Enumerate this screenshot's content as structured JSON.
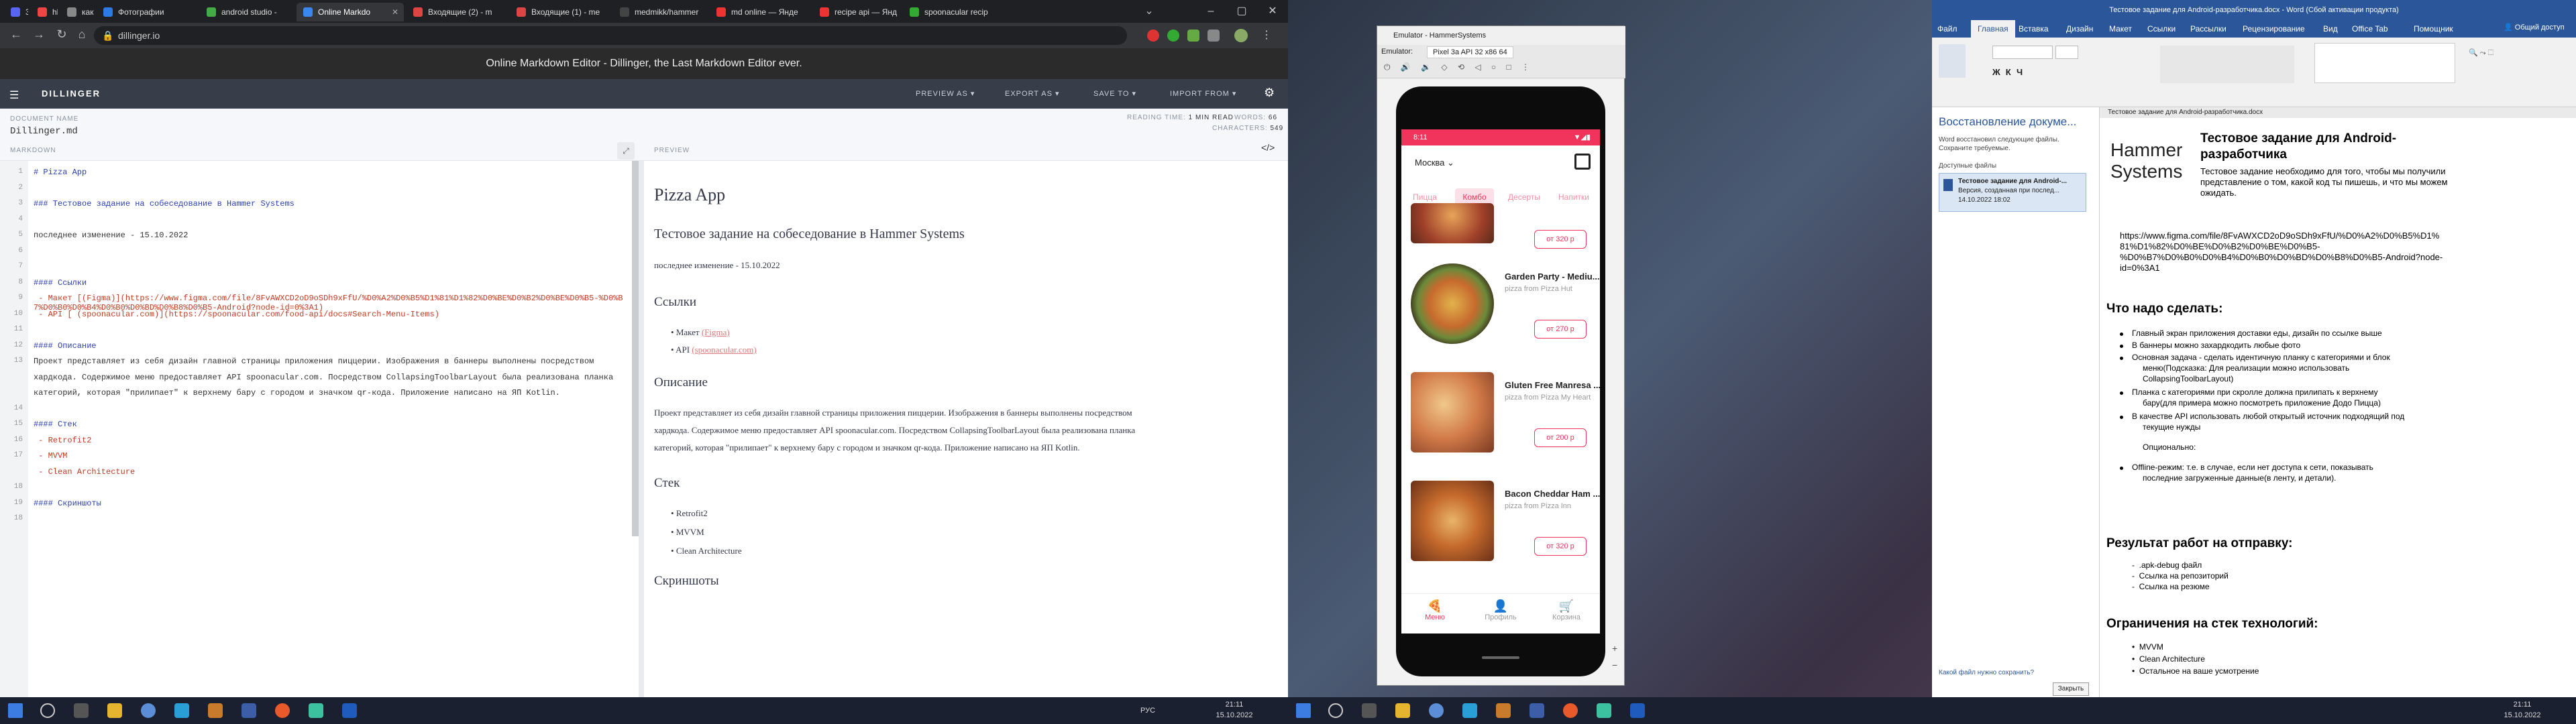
{
  "browser": {
    "tabs": [
      {
        "label": "3",
        "active": false
      },
      {
        "label": "hh",
        "active": false
      },
      {
        "label": "как",
        "active": false
      },
      {
        "label": "Фотографии",
        "active": false
      },
      {
        "label": "android studio - ",
        "active": false
      },
      {
        "label": "Online Markdo",
        "active": true
      },
      {
        "label": "Входящие (2) - m",
        "active": false
      },
      {
        "label": "Входящие (1) - me",
        "active": false
      },
      {
        "label": "medmikk/hammer",
        "active": false
      },
      {
        "label": "md online — Янде",
        "active": false
      },
      {
        "label": "recipe api — Янд",
        "active": false
      },
      {
        "label": "spoonacular recip",
        "active": false
      }
    ],
    "url": "dillinger.io",
    "page_title": "Online Markdown Editor - Dillinger, the Last Markdown Editor ever."
  },
  "dillinger": {
    "brand": "DILLINGER",
    "menu": [
      "PREVIEW AS",
      "EXPORT AS",
      "SAVE TO",
      "IMPORT FROM"
    ],
    "document_name_label": "DOCUMENT NAME",
    "document_name": "Dillinger.md",
    "reading_time_label": "READING TIME:",
    "reading_time": "1 MIN READ",
    "words_label": "WORDS:",
    "words": "66",
    "characters_label": "CHARACTERS:",
    "characters": "549",
    "markdown_label": "MARKDOWN",
    "preview_label": "PREVIEW",
    "lines": [
      {
        "n": "1",
        "text": "# Pizza App",
        "kind": "h"
      },
      {
        "n": "2",
        "text": "",
        "kind": ""
      },
      {
        "n": "3",
        "text": "### Тестовое задание на собеседование в Hammer Systems",
        "kind": "h"
      },
      {
        "n": "4",
        "text": "",
        "kind": ""
      },
      {
        "n": "5",
        "text": "последнее изменение - 15.10.2022",
        "kind": ""
      },
      {
        "n": "6",
        "text": "",
        "kind": ""
      },
      {
        "n": "7",
        "text": "",
        "kind": ""
      },
      {
        "n": "8",
        "text": "#### Ссылки",
        "kind": "h"
      },
      {
        "n": "9",
        "text": " - Макет [(Figma)](https://www.figma.com/file/8FvAWXCD2oD9oSDh9xFfU/%D0%A2%D0%B5%D1%81%D1%82%D0%BE%D0%B2%D0%BE%D0%B5-%D0%B7%D0%B0%D0%B4%D0%B0%D0%BD%D0%B8%D0%B5-Android?node-id=0%3A1)",
        "kind": "lk"
      },
      {
        "n": "10",
        "text": " - API [ (spoonacular.com)](https://spoonacular.com/food-api/docs#Search-Menu-Items)",
        "kind": "lk"
      },
      {
        "n": "11",
        "text": "",
        "kind": ""
      },
      {
        "n": "12",
        "text": "#### Описание",
        "kind": "h"
      },
      {
        "n": "13",
        "text": "Проект представляет из себя дизайн главной страницы приложения пиццерии. Изображения в баннеры выполнены посредством",
        "kind": ""
      },
      {
        "n": "",
        "text": "хардкода. Содержимое меню предоставляет API spoonacular.com. Посредством CollapsingToolbarLayout была реализована планка",
        "kind": ""
      },
      {
        "n": "",
        "text": "категорий, которая \"прилипает\" к верхнему бару с городом и значком qr-кода. Приложение написано на ЯП Kotlin.",
        "kind": ""
      },
      {
        "n": "14",
        "text": "",
        "kind": ""
      },
      {
        "n": "15",
        "text": "#### Стек",
        "kind": "h"
      },
      {
        "n": "16",
        "text": " - Retrofit2",
        "kind": "lk"
      },
      {
        "n": "17",
        "text": " - MVVM",
        "kind": "lk"
      },
      {
        "n": "",
        "text": " - Clean Architecture",
        "kind": "lk"
      },
      {
        "n": "18",
        "text": "",
        "kind": ""
      },
      {
        "n": "19",
        "text": "#### Скриншоты",
        "kind": "h"
      },
      {
        "n": "18",
        "text": "",
        "kind": ""
      }
    ],
    "preview": {
      "h1": "Pizza App",
      "h3": "Тестовое задание на собеседование в Hammer Systems",
      "modified": "последнее изменение - 15.10.2022",
      "links_h": "Ссылки",
      "link1_prefix": "Макет",
      "link1": "(Figma)",
      "link2_prefix": "API",
      "link2": "(spoonacular.com)",
      "desc_h": "Описание",
      "desc1": "Проект представляет из себя дизайн главной страницы приложения пиццерии. Изображения в баннеры выполнены посредством",
      "desc2": "хардкода. Содержимое меню предоставляет API spoonacular.com. Посредством CollapsingToolbarLayout была реализована планка",
      "desc3": "категорий, которая \"прилипает\" к верхнему бару с городом и значком qr-кода. Приложение написано на ЯП Kotlin.",
      "stack_h": "Стек",
      "stack": [
        "Retrofit2",
        "MVVM",
        "Clean Architecture"
      ],
      "screens_h": "Скриншоты"
    }
  },
  "taskbar": {
    "lang": "РУС",
    "time": "21:11",
    "date": "15.10.2022"
  },
  "emulator": {
    "title": "Emulator - HammerSystems",
    "tab": "Emulator:",
    "device": "Pixel 3a API 32 x86 64",
    "app": {
      "time": "8:11",
      "city": "Москва",
      "categories": [
        "Пицца",
        "Комбо",
        "Десерты",
        "Напитки"
      ],
      "items": [
        {
          "name": "",
          "desc": "",
          "price": "от 320 р"
        },
        {
          "name": "Garden Party - Mediu...",
          "desc": "pizza from Pizza Hut",
          "price": "от 270 р"
        },
        {
          "name": "Gluten Free Manresa ...",
          "desc": "pizza from Pizza My Heart",
          "price": "от 200 р"
        },
        {
          "name": "Bacon Cheddar Ham ...",
          "desc": "pizza from Pizza Inn",
          "price": "от 320 р"
        }
      ],
      "nav": [
        "Меню",
        "Профиль",
        "Корзина"
      ]
    }
  },
  "word": {
    "title": "Тестовое задание для Android-разработчика.docx - Word (Сбой активации продукта)",
    "ribbon_tabs": [
      "Файл",
      "Главная",
      "Вставка",
      "Дизайн",
      "Макет",
      "Ссылки",
      "Рассылки",
      "Рецензирование",
      "Вид",
      "Office Tab",
      "Помощник"
    ],
    "share": "Общий доступ",
    "recovery": {
      "title": "Восстановление докуме...",
      "text": "Word восстановил следующие файлы. Сохраните требуемые.",
      "files_label": "Доступные файлы",
      "file_name": "Тестовое задание для Android-...",
      "file_ver": "Версия, созданная при послед...",
      "file_date": "14.10.2022 18:02",
      "question": "Какой файл нужно сохранить?",
      "close": "Закрыть"
    },
    "doc_tab": "Тестовое задание для Android-разработчика.docx",
    "logo1": "Hammer",
    "logo2": "Systems",
    "heading": "Тестовое задание для Android-",
    "heading2": "разработчика",
    "intro1": "Тестовое задание необходимо для того, чтобы мы получили",
    "intro2": "представление о том, какой код ты пишешь, и что мы можем",
    "intro3": "ожидать.",
    "url1": "https://www.figma.com/file/8FvAWXCD2oD9oSDh9xFfU/%D0%A2%D0%B5%D1%",
    "url2": "81%D1%82%D0%BE%D0%B2%D0%BE%D0%B5-",
    "url3": "%D0%B7%D0%B0%D0%B4%D0%B0%D0%BD%D0%B8%D0%B5-Android?node-",
    "url4": "id=0%3A1",
    "todo_h": "Что надо сделать:",
    "todo": [
      "Главный экран приложения доставки еды, дизайн по ссылке выше",
      "В баннеры можно захардкодить любые фото",
      "Основная задача - сделать идентичную планку с категориями и блок",
      "меню(Подсказка: Для реализации можно использовать",
      "CollapsingToolbarLayout)",
      "Планка с категориями при скролле должна прилипать к верхнему",
      "бару(для примера можно посмотреть приложение Додо Пицца)",
      "В качестве API использовать любой открытый источник подходящий под",
      "текущие нужды",
      "Опционально:",
      "Offline-режим: т.е. в случае, если нет доступа к сети, показывать",
      "последние загруженные данные(в ленту, и детали)."
    ],
    "result_h": "Результат работ на отправку:",
    "result": [
      ".apk-debug файл",
      "Ссылка на репозиторий",
      "Ссылка на резюме"
    ],
    "stack_h": "Ограничения на стек технологий:",
    "stack": [
      "MVVM",
      "Clean Architecture",
      "Остальное на ваше усмотрение"
    ]
  }
}
